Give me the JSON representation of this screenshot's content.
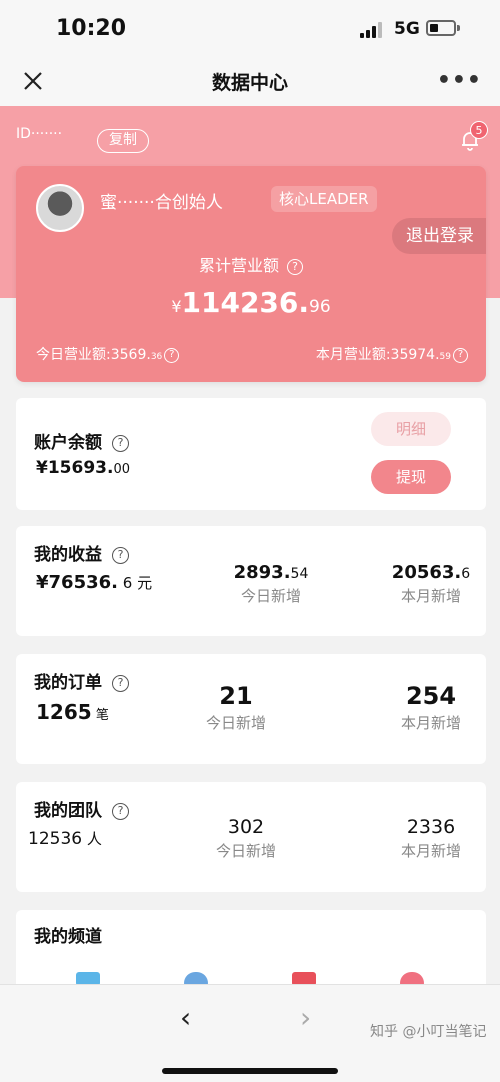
{
  "status_bar": {
    "time": "10:20",
    "network": "5G"
  },
  "nav": {
    "title": "数据中心",
    "more_icon": "more-dots-icon",
    "close_icon": "close-icon"
  },
  "header": {
    "id_text": "ID·······",
    "copy_label": "复制",
    "notification_count": "5"
  },
  "revenue_card": {
    "user_name": "蜜·······合创始人",
    "tag": "核心LEADER",
    "logout_label": "退出登录",
    "total_label": "累计营业额",
    "total_currency": "¥",
    "total_int": "114236.",
    "total_dec": "96",
    "today_label": "今日营业额:",
    "today_int": "3569.",
    "today_dec": "36",
    "month_label": "本月营业额:",
    "month_int": "35974.",
    "month_dec": "59"
  },
  "balance": {
    "title": "账户余额",
    "amount_int": "¥15693.",
    "amount_dec": "00",
    "detail_label": "明细",
    "withdraw_label": "提现"
  },
  "earnings": {
    "title": "我的收益",
    "total_int": "¥76536.",
    "total_dec": "6 元",
    "today_int": "2893.",
    "today_dec": "54",
    "today_label": "今日新增",
    "month_int": "20563.",
    "month_dec": "6",
    "month_label": "本月新增"
  },
  "orders": {
    "title": "我的订单",
    "total": "1265",
    "unit": "笔",
    "today": "21",
    "today_label": "今日新增",
    "month": "254",
    "month_label": "本月新增"
  },
  "team": {
    "title": "我的团队",
    "total": "12536",
    "unit": "人",
    "today": "302",
    "today_label": "今日新增",
    "month": "2336",
    "month_label": "本月新增"
  },
  "channel": {
    "title": "我的频道"
  },
  "bottom": {
    "back": "‹",
    "forward": "›",
    "watermark": "知乎 @小叮当笔记"
  },
  "colors": {
    "pink_band": "#f6a0a6",
    "card_pink": "#f2888c",
    "button_pink": "#f2868c"
  }
}
